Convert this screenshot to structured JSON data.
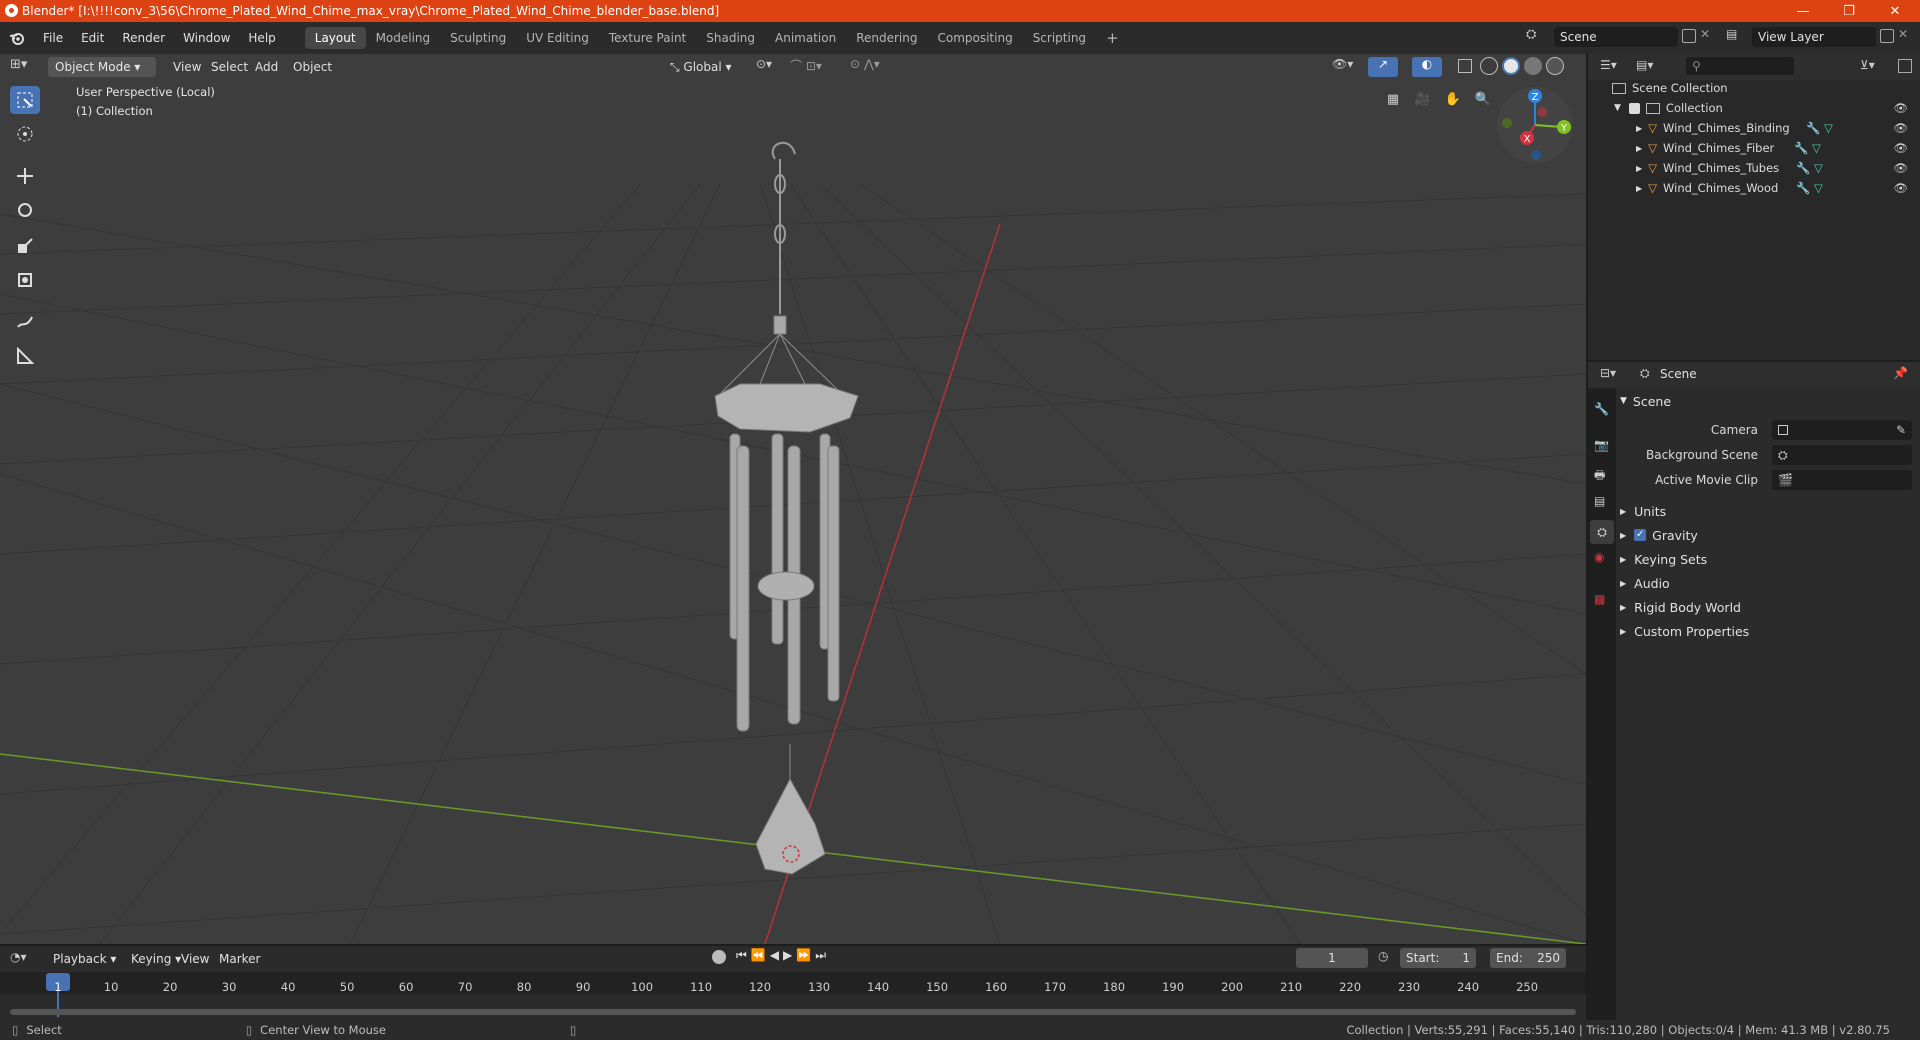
{
  "window": {
    "title": "Blender* [I:\\!!!!conv_3\\56\\Chrome_Plated_Wind_Chime_max_vray\\Chrome_Plated_Wind_Chime_blender_base.blend]",
    "minimize": "—",
    "maximize": "❐",
    "close": "✕"
  },
  "menu": [
    "File",
    "Edit",
    "Render",
    "Window",
    "Help"
  ],
  "workspaces": [
    "Layout",
    "Modeling",
    "Sculpting",
    "UV Editing",
    "Texture Paint",
    "Shading",
    "Animation",
    "Rendering",
    "Compositing",
    "Scripting"
  ],
  "workspace_add": "+",
  "active_workspace": "Layout",
  "scene_field": "Scene",
  "view_layer_field": "View Layer",
  "viewport": {
    "mode": "Object Mode",
    "menus": [
      "View",
      "Select",
      "Add",
      "Object"
    ],
    "transform_orientation": "Global",
    "overlay_line1": "User Perspective (Local)",
    "overlay_line2": "(1) Collection",
    "gizmo": {
      "z": "Z",
      "y": "Y",
      "x": "X"
    }
  },
  "outliner": {
    "root": "Scene Collection",
    "collection": "Collection",
    "items": [
      {
        "label": "Wind_Chimes_Binding"
      },
      {
        "label": "Wind_Chimes_Fiber"
      },
      {
        "label": "Wind_Chimes_Tubes"
      },
      {
        "label": "Wind_Chimes_Wood"
      }
    ]
  },
  "properties": {
    "header": "Scene",
    "section": "Scene",
    "camera_label": "Camera",
    "background_label": "Background Scene",
    "movie_clip_label": "Active Movie Clip",
    "subsections": [
      "Units",
      "Gravity",
      "Keying Sets",
      "Audio",
      "Rigid Body World",
      "Custom Properties"
    ]
  },
  "timeline": {
    "menus": [
      "Playback",
      "Keying",
      "View",
      "Marker"
    ],
    "current_frame": "1",
    "start_label": "Start:",
    "start": "1",
    "end_label": "End:",
    "end": "250",
    "ticks": [
      "1",
      "10",
      "20",
      "30",
      "40",
      "50",
      "60",
      "70",
      "80",
      "90",
      "100",
      "110",
      "120",
      "130",
      "140",
      "150",
      "160",
      "170",
      "180",
      "190",
      "200",
      "210",
      "220",
      "230",
      "240",
      "250"
    ]
  },
  "status": {
    "select": "Select",
    "center_view": "Center View to Mouse",
    "stats": "Collection | Verts:55,291 | Faces:55,140 | Tris:110,280 | Objects:0/4 | Mem: 41.3 MB | v2.80.75"
  },
  "colors": {
    "titlebar": "#dd4312",
    "accent": "#4772b3",
    "viewport_bg": "#3d3d3d",
    "object_orange": "#e8a040",
    "axis_x": "#d1333f",
    "axis_y": "#80c31f",
    "axis_z": "#2c84dd"
  }
}
